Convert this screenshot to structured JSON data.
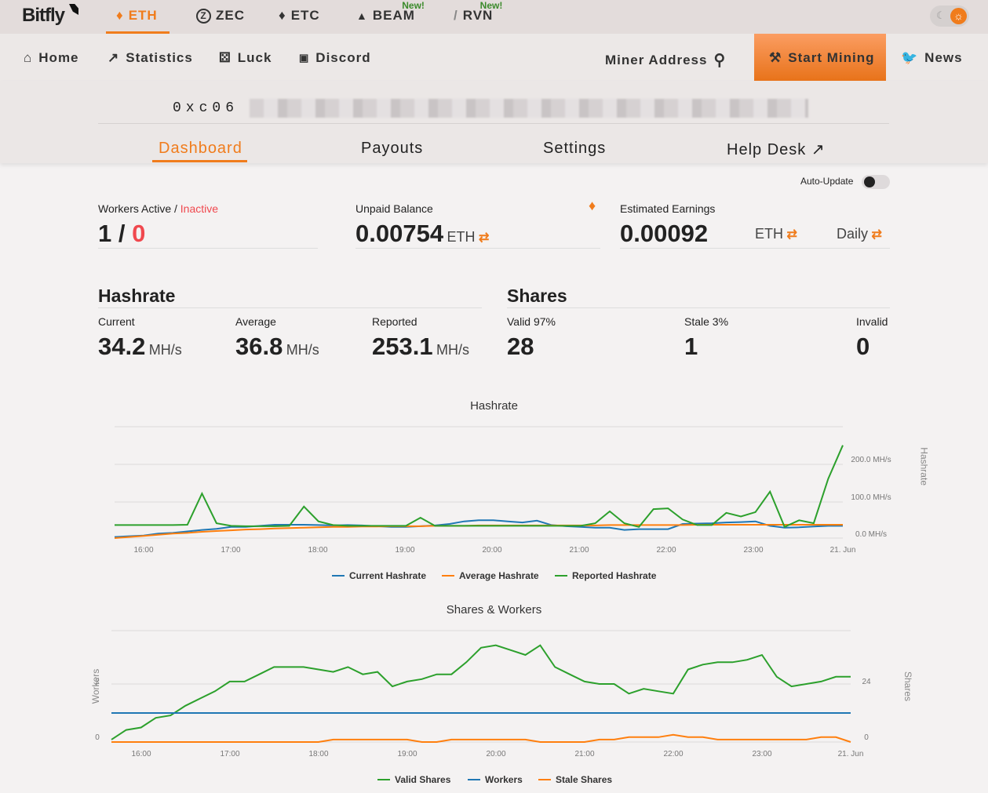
{
  "brand": "Bitfly",
  "coins": [
    {
      "label": "ETH",
      "active": true
    },
    {
      "label": "ZEC"
    },
    {
      "label": "ETC"
    },
    {
      "label": "BEAM",
      "badge": "New!"
    },
    {
      "label": "RVN",
      "badge": "New!"
    }
  ],
  "nav": {
    "home": "Home",
    "statistics": "Statistics",
    "luck": "Luck",
    "discord": "Discord",
    "miner_address": "Miner Address",
    "start_mining": "Start Mining",
    "news": "News"
  },
  "address": "0xc06",
  "tabs": {
    "dashboard": "Dashboard",
    "payouts": "Payouts",
    "settings": "Settings",
    "helpdesk": "Help Desk"
  },
  "auto_update": {
    "label": "Auto-Update",
    "on": false
  },
  "workers": {
    "label": "Workers Active",
    "sep": " / ",
    "inactive_label": "Inactive",
    "active": "1",
    "slash": " / ",
    "inactive": "0"
  },
  "unpaid": {
    "label": "Unpaid Balance",
    "value": "0.00754",
    "unit": "ETH"
  },
  "estimated": {
    "label": "Estimated Earnings",
    "value": "0.00092",
    "unit": "ETH",
    "period": "Daily"
  },
  "hashrate": {
    "title": "Hashrate",
    "current_label": "Current",
    "current": "34.2",
    "average_label": "Average",
    "average": "36.8",
    "reported_label": "Reported",
    "reported": "253.1",
    "unit": "MH/s"
  },
  "shares": {
    "title": "Shares",
    "valid_label": "Valid 97%",
    "valid": "28",
    "stale_label": "Stale 3%",
    "stale": "1",
    "invalid_label": "Invalid",
    "invalid": "0"
  },
  "colors": {
    "accent": "#f07c1c",
    "current": "#1f77b4",
    "average": "#ff7f0e",
    "reported": "#2ca02c",
    "inactive": "#f0484e"
  },
  "chart_data": [
    {
      "type": "line",
      "title": "Hashrate",
      "ylabel": "Hashrate",
      "ylim": [
        0,
        300
      ],
      "yticks": [
        "0.0 MH/s",
        "100.0 MH/s",
        "200.0 MH/s"
      ],
      "xticks": [
        "16:00",
        "17:00",
        "18:00",
        "19:00",
        "20:00",
        "21:00",
        "22:00",
        "23:00",
        "21. Jun"
      ],
      "x_start": "15:40",
      "x_step_minutes": 10,
      "legend": "bottom",
      "series": [
        {
          "name": "Current Hashrate",
          "values": [
            3,
            5,
            7,
            12,
            14,
            18,
            22,
            25,
            30,
            30,
            33,
            36,
            36,
            36,
            35,
            34,
            35,
            34,
            32,
            30,
            30,
            32,
            34,
            38,
            45,
            48,
            48,
            45,
            42,
            47,
            35,
            32,
            30,
            28,
            28,
            22,
            24,
            24,
            24,
            38,
            39,
            40,
            42,
            43,
            45,
            33,
            28,
            29,
            31,
            33,
            33
          ]
        },
        {
          "name": "Average Hashrate",
          "values": [
            0,
            3,
            6,
            9,
            12,
            14,
            17,
            19,
            21,
            23,
            24,
            26,
            27,
            28,
            29,
            30,
            30,
            31,
            31,
            32,
            32,
            32,
            33,
            33,
            33,
            34,
            34,
            34,
            34,
            34,
            34,
            34,
            34,
            34,
            35,
            35,
            35,
            35,
            35,
            35,
            36,
            36,
            36,
            36,
            36,
            36,
            36,
            36,
            36,
            36,
            36
          ]
        },
        {
          "name": "Reported Hashrate",
          "values": [
            35,
            35,
            35,
            35,
            35,
            36,
            120,
            40,
            33,
            32,
            32,
            32,
            33,
            85,
            45,
            35,
            33,
            33,
            33,
            33,
            33,
            55,
            33,
            33,
            33,
            33,
            33,
            33,
            33,
            33,
            33,
            33,
            33,
            40,
            72,
            40,
            30,
            78,
            80,
            50,
            35,
            35,
            68,
            58,
            70,
            125,
            30,
            48,
            40,
            160,
            250
          ]
        }
      ]
    },
    {
      "type": "line",
      "title": "Shares & Workers",
      "ylabel_left": "Workers",
      "ylabel_right": "Shares",
      "ylim_left": [
        0,
        4
      ],
      "ylim_right": [
        0,
        48
      ],
      "yticks_left": [
        "0",
        "2"
      ],
      "yticks_right": [
        "0",
        "24"
      ],
      "xticks": [
        "16:00",
        "17:00",
        "18:00",
        "19:00",
        "20:00",
        "21:00",
        "22:00",
        "23:00",
        "21. Jun"
      ],
      "x_start": "15:40",
      "x_step_minutes": 10,
      "legend": "bottom",
      "series": [
        {
          "name": "Valid Shares",
          "axis": "right",
          "values": [
            1,
            5,
            6,
            10,
            11,
            15,
            18,
            21,
            25,
            25,
            28,
            31,
            31,
            31,
            30,
            29,
            31,
            28,
            29,
            23,
            25,
            26,
            28,
            28,
            33,
            39,
            40,
            38,
            36,
            40,
            31,
            28,
            25,
            24,
            24,
            20,
            22,
            21,
            20,
            30,
            32,
            33,
            33,
            34,
            36,
            27,
            23,
            24,
            25,
            27,
            27
          ]
        },
        {
          "name": "Workers",
          "axis": "left",
          "values": [
            1,
            1,
            1,
            1,
            1,
            1,
            1,
            1,
            1,
            1,
            1,
            1,
            1,
            1,
            1,
            1,
            1,
            1,
            1,
            1,
            1,
            1,
            1,
            1,
            1,
            1,
            1,
            1,
            1,
            1,
            1,
            1,
            1,
            1,
            1,
            1,
            1,
            1,
            1,
            1,
            1,
            1,
            1,
            1,
            1,
            1,
            1,
            1,
            1,
            1,
            1
          ]
        },
        {
          "name": "Stale Shares",
          "axis": "right",
          "values": [
            0,
            0,
            0,
            0,
            0,
            0,
            0,
            0,
            0,
            0,
            0,
            0,
            0,
            0,
            0,
            1,
            1,
            1,
            1,
            1,
            1,
            0,
            0,
            1,
            1,
            1,
            1,
            1,
            1,
            0,
            0,
            0,
            0,
            1,
            1,
            2,
            2,
            2,
            3,
            2,
            2,
            1,
            1,
            1,
            1,
            1,
            1,
            1,
            2,
            2,
            0
          ]
        }
      ]
    }
  ]
}
